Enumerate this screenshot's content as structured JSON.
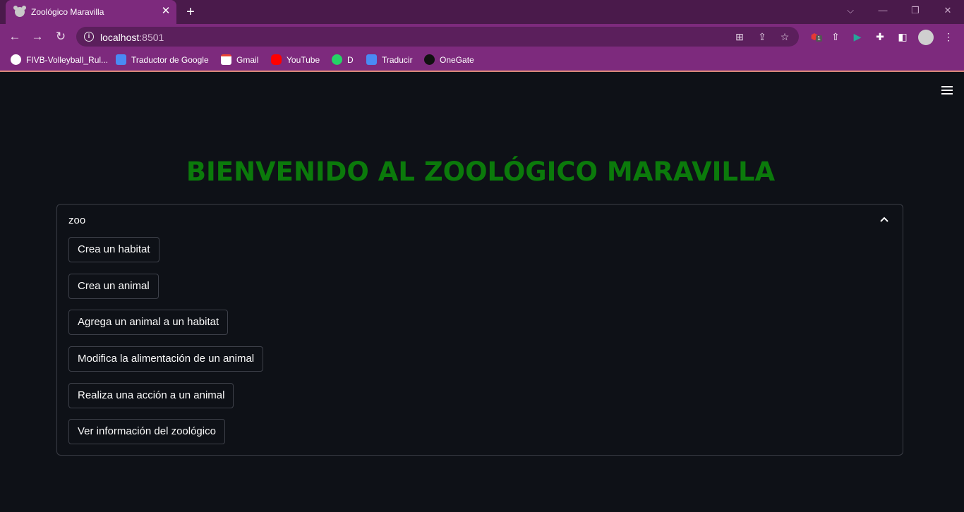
{
  "browser": {
    "tab_title": "Zoológico Maravilla",
    "tab_close": "✕",
    "new_tab": "+",
    "url_host": "localhost",
    "url_port": ":8501",
    "bookmarks": [
      {
        "label": "FIVB-Volleyball_Rul...",
        "color": "#ffffff"
      },
      {
        "label": "Traductor de Google",
        "color": "#4a8af4"
      },
      {
        "label": "Gmail",
        "color": "#ea4335"
      },
      {
        "label": "YouTube",
        "color": "#ff0000"
      },
      {
        "label": "D",
        "color": "#25d366"
      },
      {
        "label": "Traducir",
        "color": "#4a8af4"
      },
      {
        "label": "OneGate",
        "color": "#111111"
      }
    ],
    "extension_badge": "1"
  },
  "app": {
    "title": "BIENVENIDO AL ZOOLÓGICO MARAVILLA",
    "title_color": "#0b7a0b",
    "expander_label": "zoo",
    "buttons": [
      "Crea un habitat",
      "Crea un animal",
      "Agrega un animal a un habitat",
      "Modifica la alimentación de un animal",
      "Realiza una acción a un animal",
      "Ver información del zoológico"
    ]
  }
}
